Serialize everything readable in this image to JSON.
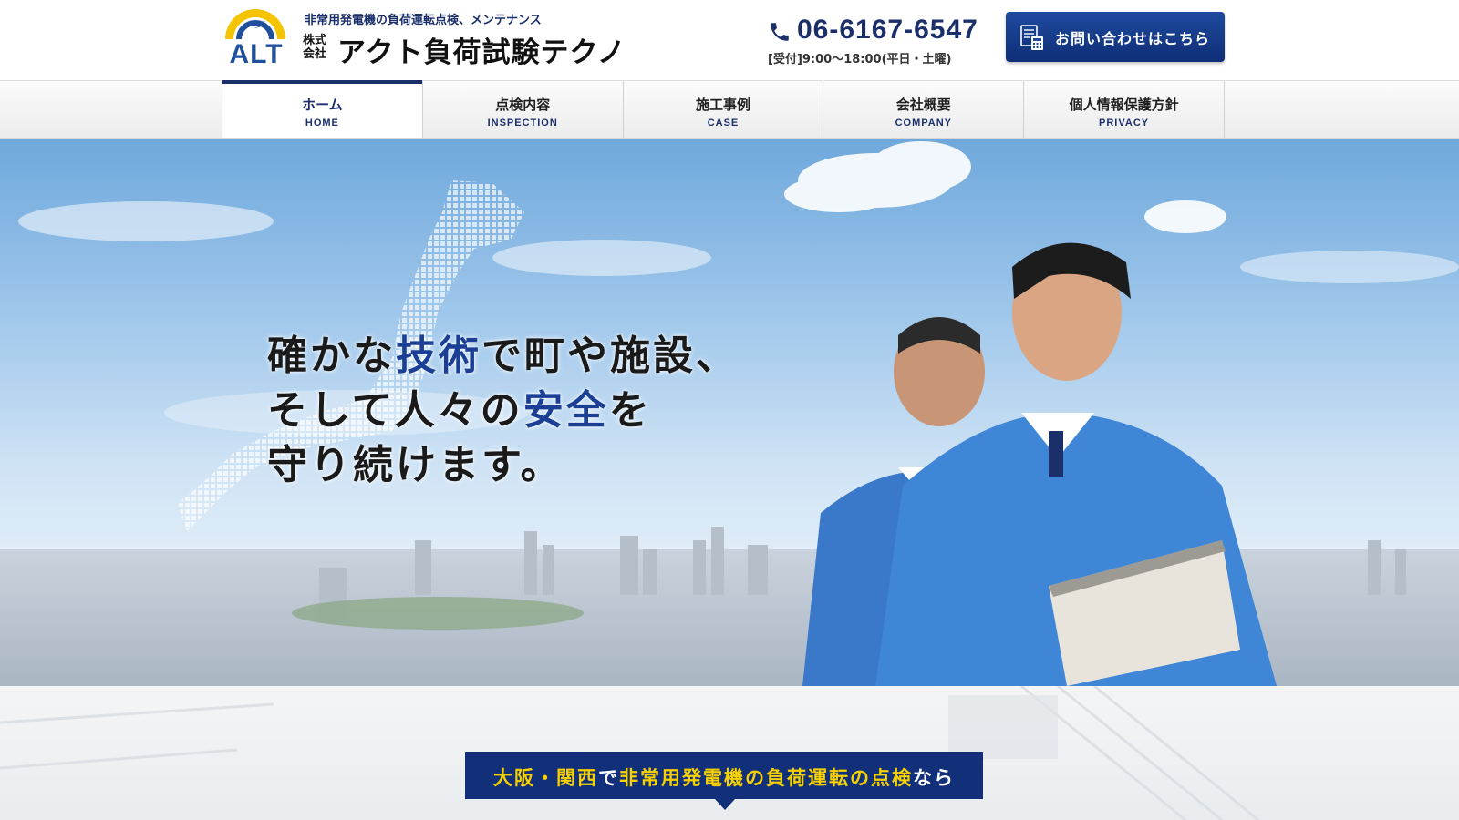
{
  "header": {
    "logo_text": "ALT",
    "tagline": "非常用発電機の負荷運転点検、メンテナンス",
    "corp_type_line1": "株式",
    "corp_type_line2": "会社",
    "company_name": "アクト負荷試験テクノ",
    "phone_number": "06-6167-6547",
    "phone_hours": "[受付]9:00〜18:00(平日・土曜)",
    "contact_label": "お問い合わせはこちら",
    "icons": {
      "phone": "phone-icon",
      "contact": "document-calculator-icon"
    }
  },
  "nav": {
    "items": [
      {
        "jp": "ホーム",
        "en": "HOME",
        "active": true
      },
      {
        "jp": "点検内容",
        "en": "INSPECTION",
        "active": false
      },
      {
        "jp": "施工事例",
        "en": "CASE",
        "active": false
      },
      {
        "jp": "会社概要",
        "en": "COMPANY",
        "active": false
      },
      {
        "jp": "個人情報保護方針",
        "en": "PRIVACY",
        "active": false
      }
    ]
  },
  "hero": {
    "line1_a": "確かな",
    "line1_accent": "技術",
    "line1_b": "で町や施設、",
    "line2_a": "そして人々の",
    "line2_accent": "安全",
    "line2_b": "を",
    "line3": "守り続けます。"
  },
  "banner": {
    "part1": "大阪・関西",
    "part2": "で",
    "part3": "非常用発電機の負荷運転の点検",
    "part4": "なら"
  },
  "colors": {
    "brand_navy": "#1b2f6b",
    "button_blue": "#1e4a9e",
    "logo_yellow": "#f5c400",
    "banner_yellow": "#f6d000"
  }
}
